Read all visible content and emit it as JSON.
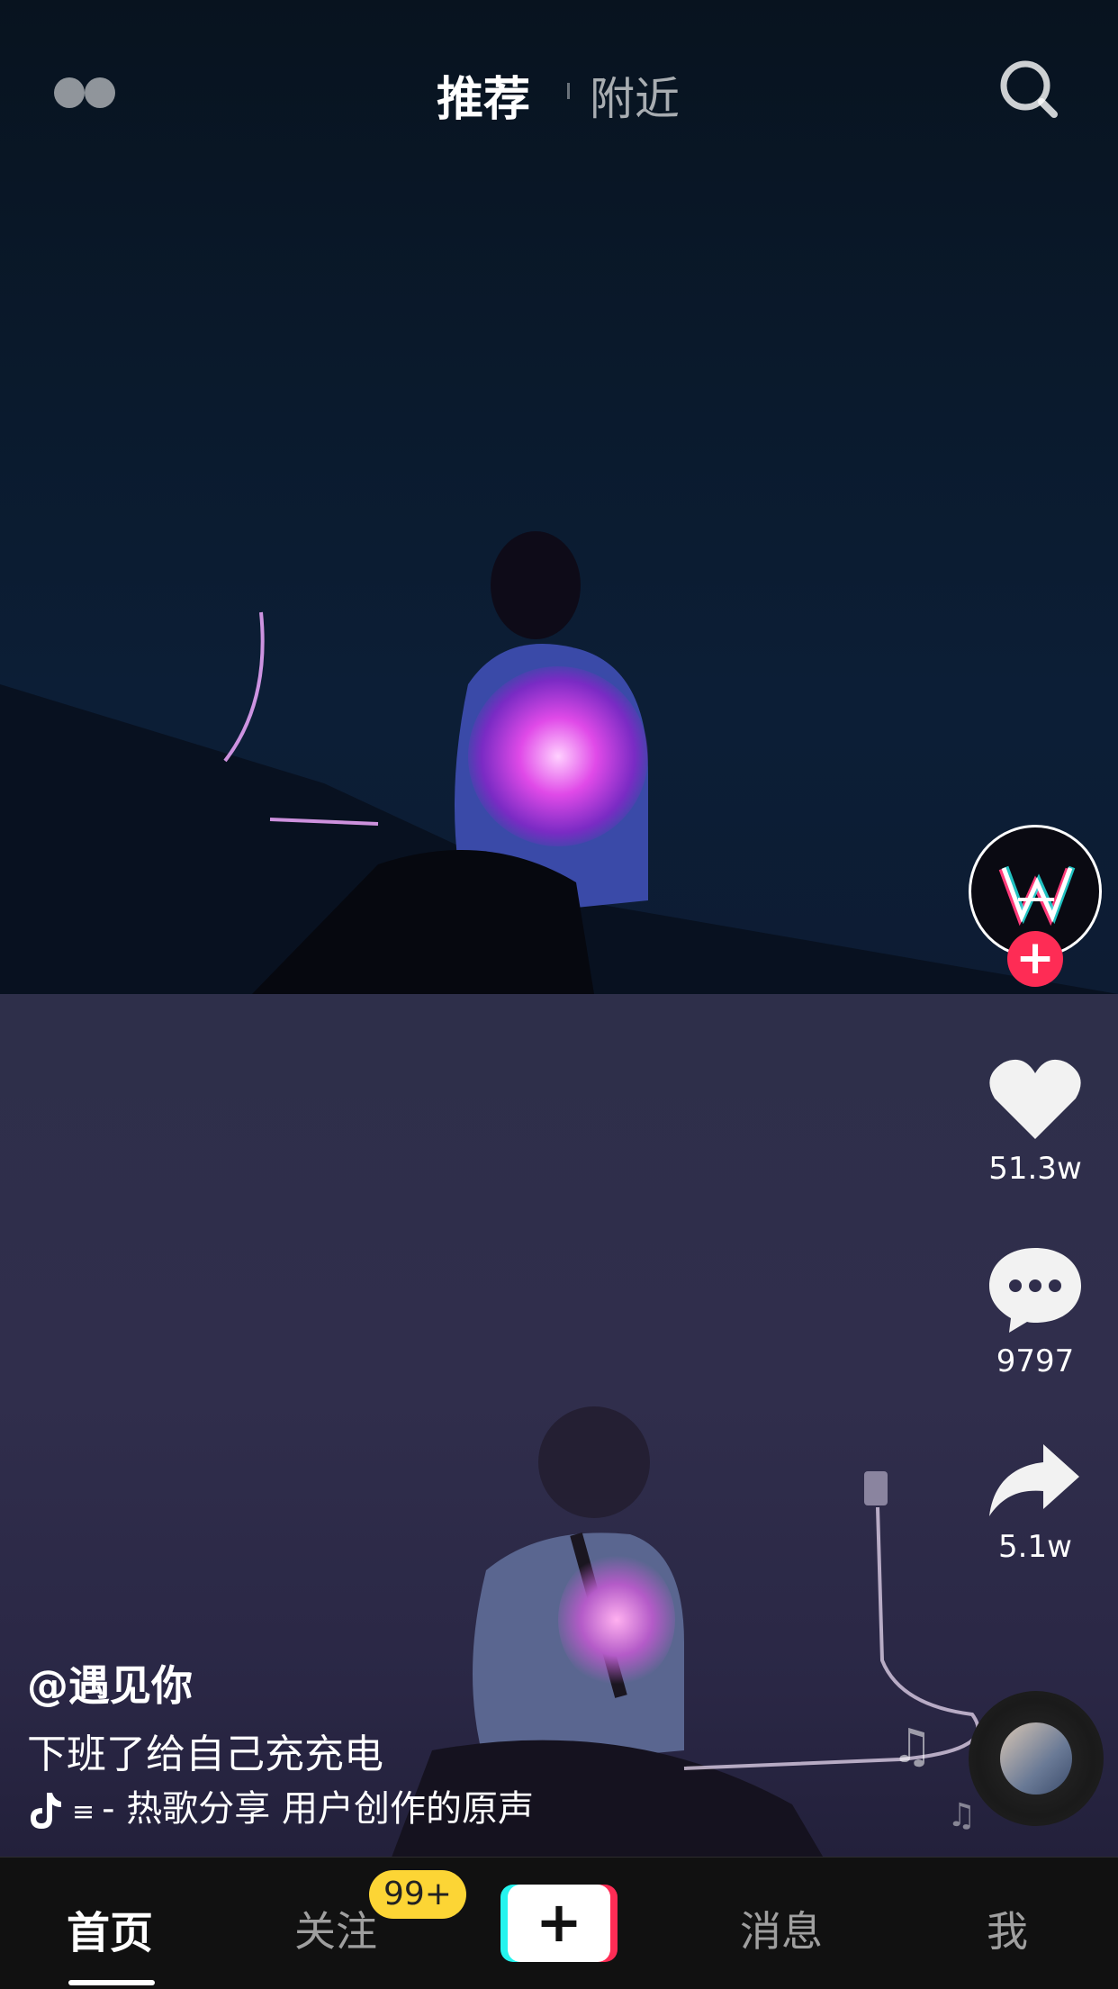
{
  "header": {
    "tabs": [
      "推荐",
      "附近"
    ],
    "active_tab": "推荐"
  },
  "video": {
    "username": "@遇见你",
    "caption": "下班了给自己充充电",
    "music": "- 热歌分享    用户创作的原声"
  },
  "actions": {
    "likes": "51.3w",
    "comments": "9797",
    "shares": "5.1w"
  },
  "bottom_nav": {
    "home": "首页",
    "follow": "关注",
    "follow_badge": "99+",
    "create": "+",
    "messages": "消息",
    "me": "我"
  },
  "colors": {
    "accent_red": "#fe2c55",
    "accent_cyan": "#25f4ee",
    "badge_yellow": "#fcd535",
    "nav_bg": "#111111"
  },
  "icons": [
    "menu-icon",
    "search-icon",
    "heart-icon",
    "comment-icon",
    "share-icon",
    "music-note-icon",
    "tiktok-icon",
    "plus-icon"
  ]
}
